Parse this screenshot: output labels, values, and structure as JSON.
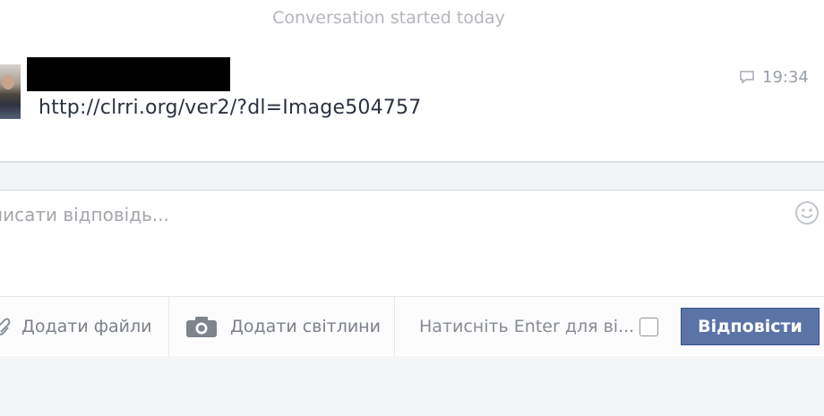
{
  "conversation": {
    "started_label": "Conversation started today"
  },
  "message": {
    "text": "http://clrri.org/ver2/?dl=Image504757",
    "time": "19:34",
    "icons": {
      "avatar": "user-avatar",
      "sender": "redacted-name",
      "time": "chat-bubble-icon"
    }
  },
  "composer": {
    "placeholder": "писати відповідь...",
    "smiley_icon": "smiley-icon",
    "add_files_label": "Додати файли",
    "add_files_icon": "paperclip-icon",
    "add_photos_label": "Додати світлини",
    "add_photos_icon": "camera-icon",
    "enter_hint": "Натисніть Enter для ві...",
    "reply_label": "Відповісти"
  },
  "colors": {
    "reply_button": "#5b74a8",
    "muted_text": "#a3a6ab",
    "link_text": "#2b3240"
  }
}
